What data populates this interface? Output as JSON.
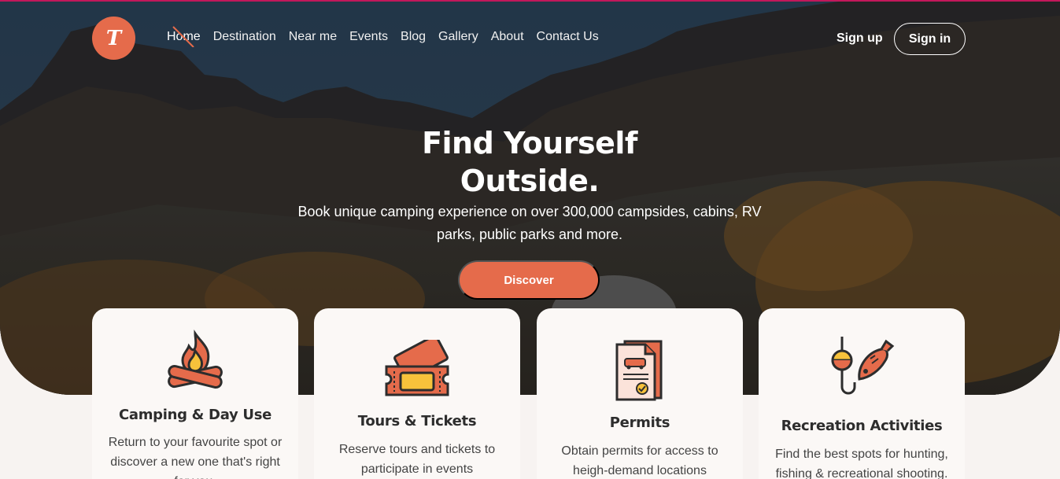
{
  "brand": {
    "logo_letter": "T",
    "accent": "#e56b4b"
  },
  "nav": {
    "items": [
      {
        "label": "Home",
        "active": true
      },
      {
        "label": "Destination"
      },
      {
        "label": "Near me"
      },
      {
        "label": "Events"
      },
      {
        "label": "Blog"
      },
      {
        "label": "Gallery"
      },
      {
        "label": "About"
      },
      {
        "label": "Contact Us"
      }
    ],
    "signup": "Sign up",
    "signin": "Sign in"
  },
  "hero": {
    "title": "Find Yourself Outside.",
    "subtitle": "Book unique camping experience on over 300,000 campsides, cabins, RV parks, public parks and more.",
    "cta": "Discover"
  },
  "cards": [
    {
      "icon": "campfire-icon",
      "title": "Camping & Day Use",
      "text": "Return to your favourite spot or discover a new one that's right for you."
    },
    {
      "icon": "tickets-icon",
      "title": "Tours & Tickets",
      "text": "Reserve tours and tickets to participate in events"
    },
    {
      "icon": "permit-document-icon",
      "title": "Permits",
      "text": "Obtain permits for access to heigh-demand locations"
    },
    {
      "icon": "fishing-icon",
      "title": "Recreation Activities",
      "text": "Find the best spots for hunting, fishing & recreational shooting."
    }
  ]
}
